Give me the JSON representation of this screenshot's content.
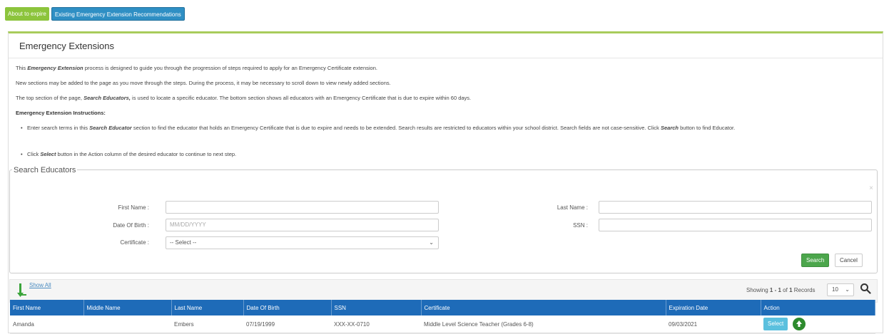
{
  "tabs": [
    {
      "label": "About to expire"
    },
    {
      "label": "Existing Emergency Extension Recommendations"
    }
  ],
  "panel": {
    "title": "Emergency Extensions",
    "intro": {
      "p1_a": "This ",
      "p1_b": "Emergency Extension",
      "p1_c": " process is designed to guide you through the progression of steps required to apply for an Emergency Certificate extension.",
      "p2": "New sections may be added to the page as you move through the steps. During the process, it may be necessary to scroll down to view newly added sections.",
      "p3_a": "The top section of the page, ",
      "p3_b": "Search Educators,",
      "p3_c": " is used to locate a specific educator. The bottom section shows all educators with an Emergency Certificate that is due to expire within 60 days.",
      "instructions_heading": "Emergency Extension Instructions:",
      "bullet1_a": "Enter search terms in this ",
      "bullet1_b": "Search Educator",
      "bullet1_c": " section to find the educator that holds an Emergency Certificate that is due to expire and needs to be extended. Search results are restricted to educators within your school district. Search fields are not case-sensitive. Click ",
      "bullet1_d": "Search",
      "bullet1_e": " button to find Educator.",
      "bullet2_a": "Click ",
      "bullet2_b": "Select",
      "bullet2_c": " button in the Action column of the desired educator to continue to next step."
    }
  },
  "search": {
    "legend": "Search Educators",
    "close": "×",
    "first_name_label": "First Name :",
    "first_name_value": "",
    "last_name_label": "Last Name :",
    "last_name_value": "",
    "dob_label": "Date Of Birth :",
    "dob_placeholder": "MM/DD/YYYY",
    "ssn_label": "SSN :",
    "ssn_value": "",
    "certificate_label": "Certificate :",
    "certificate_selected": "-- Select --",
    "search_button": "Search",
    "cancel_button": "Cancel"
  },
  "results": {
    "show_all": "Show All",
    "showing_prefix": "Showing ",
    "showing_range": "1 - 1",
    "showing_mid": " of ",
    "showing_total": "1",
    "showing_suffix": " Records",
    "page_size": "10",
    "columns": [
      "First Name",
      "Middle Name",
      "Last Name",
      "Date Of Birth",
      "SSN",
      "Certificate",
      "Expiration Date",
      "Action"
    ],
    "rows": [
      {
        "first_name": "Amanda",
        "middle_name": "",
        "last_name": "Embers",
        "dob": "07/19/1999",
        "ssn": "XXX-XX-0710",
        "certificate": "Middle Level Science Teacher (Grades 6-8)",
        "expiration": "09/03/2021",
        "action_label": "Select"
      }
    ]
  },
  "colors": {
    "accent_green": "#8cc43c",
    "tab_blue": "#2f8fc4",
    "header_blue": "#1e6bb8",
    "search_green": "#4ca64c",
    "select_cyan": "#5bc0de"
  }
}
